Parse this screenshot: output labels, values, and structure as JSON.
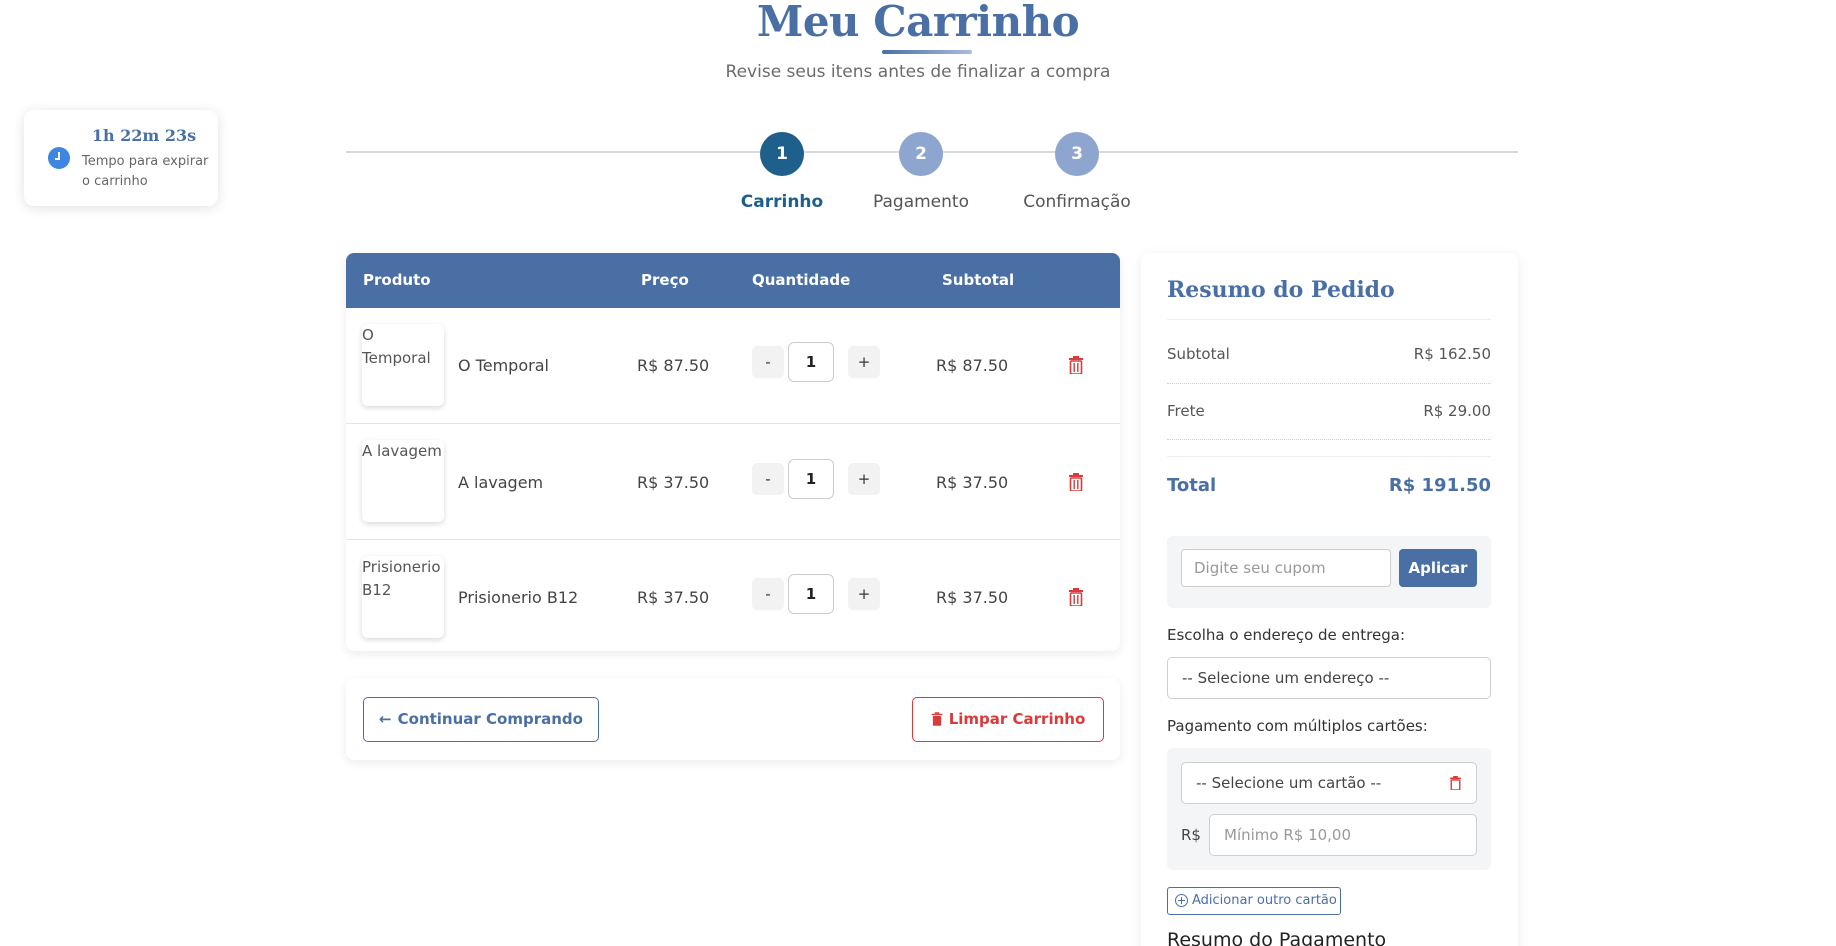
{
  "header": {
    "title": "Meu Carrinho",
    "subtitle": "Revise seus itens antes de finalizar a compra"
  },
  "timer": {
    "value": "1h 22m 23s",
    "label": "Tempo para expirar o carrinho",
    "icon": "clock-icon"
  },
  "steps": [
    {
      "number": "1",
      "label": "Carrinho",
      "active": true,
      "color": "#1f5f8b"
    },
    {
      "number": "2",
      "label": "Pagamento",
      "active": false,
      "color": "#8ea6cf"
    },
    {
      "number": "3",
      "label": "Confirmação",
      "active": false,
      "color": "#8ea6cf"
    }
  ],
  "cart": {
    "columns": [
      "Produto",
      "Preço",
      "Quantidade",
      "Subtotal"
    ],
    "items": [
      {
        "image_alt": "O Temporal",
        "name": "O Temporal",
        "price": "R$ 87.50",
        "quantity": "1",
        "subtotal": "R$ 87.50"
      },
      {
        "image_alt": "A lavagem",
        "name": "A lavagem",
        "price": "R$ 37.50",
        "quantity": "1",
        "subtotal": "R$ 37.50"
      },
      {
        "image_alt": "Prisionerio B12",
        "name": "Prisionerio B12",
        "price": "R$ 37.50",
        "quantity": "1",
        "subtotal": "R$ 37.50"
      }
    ],
    "minus_label": "-",
    "plus_label": "+"
  },
  "actions": {
    "continue_label": "Continuar Comprando",
    "clear_label": "Limpar Carrinho"
  },
  "summary": {
    "title": "Resumo do Pedido",
    "subtotal_label": "Subtotal",
    "subtotal_value": "R$ 162.50",
    "shipping_label": "Frete",
    "shipping_value": "R$ 29.00",
    "total_label": "Total",
    "total_value": "R$ 191.50",
    "coupon_placeholder": "Digite seu cupom",
    "coupon_button": "Aplicar",
    "address_label": "Escolha o endereço de entrega:",
    "address_select": "-- Selecione um endereço --",
    "cards_label": "Pagamento com múltiplos cartões:",
    "card_select": "-- Selecione um cartão --",
    "currency_label": "R$",
    "amount_placeholder": "Mínimo R$ 10,00",
    "add_card_label": "Adicionar outro cartão",
    "payment_summary_title": "Resumo do Pagamento"
  },
  "colors": {
    "primary": "#4a6fa5",
    "danger": "#d93a3a",
    "active_step": "#1f5f8b",
    "inactive_step": "#8ea6cf"
  }
}
